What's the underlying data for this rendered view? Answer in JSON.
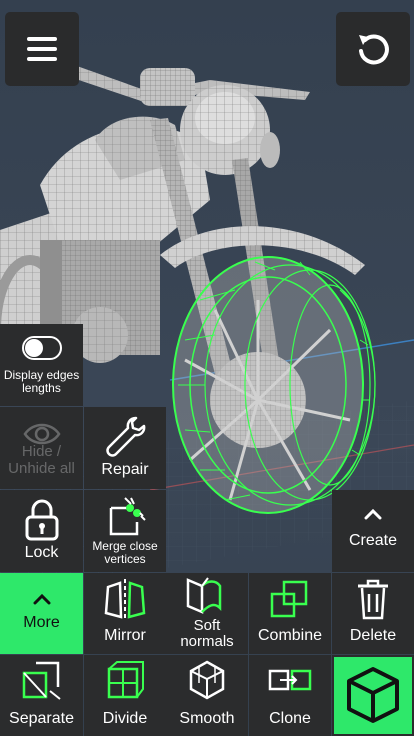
{
  "top": {
    "menu_icon": "hamburger-icon",
    "undo_icon": "undo-icon"
  },
  "side": {
    "display_edges": {
      "label": "Display edges lengths",
      "icon": "toggle-icon",
      "enabled": false
    },
    "hide_unhide": {
      "label": "Hide / Unhide all",
      "icon": "eye-icon"
    },
    "repair": {
      "label": "Repair",
      "icon": "wrench-icon"
    },
    "lock": {
      "label": "Lock",
      "icon": "padlock-icon"
    },
    "merge": {
      "label": "Merge close vertices",
      "icon": "merge-vertices-icon"
    },
    "create": {
      "label": "Create",
      "icon": "chevron-up-icon"
    }
  },
  "toolbar": {
    "row1": [
      {
        "key": "more",
        "label": "More",
        "icon": "chevron-up-icon"
      },
      {
        "key": "mirror",
        "label": "Mirror",
        "icon": "mirror-icon"
      },
      {
        "key": "soft_normals",
        "label": "Soft normals",
        "icon": "soft-normals-icon"
      },
      {
        "key": "combine",
        "label": "Combine",
        "icon": "combine-icon"
      },
      {
        "key": "delete",
        "label": "Delete",
        "icon": "trash-icon"
      }
    ],
    "row2": [
      {
        "key": "separate",
        "label": "Separate",
        "icon": "separate-icon"
      },
      {
        "key": "divide",
        "label": "Divide",
        "icon": "divide-icon"
      },
      {
        "key": "smooth",
        "label": "Smooth",
        "icon": "smooth-icon"
      },
      {
        "key": "clone",
        "label": "Clone",
        "icon": "clone-icon"
      },
      {
        "key": "object_mode",
        "label": "",
        "icon": "cube-icon"
      }
    ]
  },
  "colors": {
    "accent": "#2ee86a",
    "panel": "#2b2c2d",
    "viewport": "#36424f",
    "mesh": "#bdbdbd",
    "selection": "#39ff4f"
  }
}
